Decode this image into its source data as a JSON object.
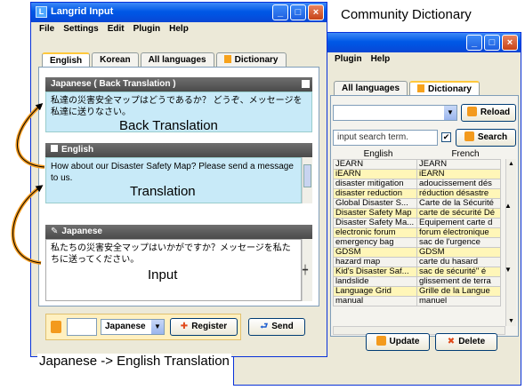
{
  "captions": {
    "community_dictionary": "Community Dictionary",
    "back_translation": "Back Translation",
    "translation": "Translation",
    "input": "Input",
    "bottom": "Japanese -> English Translation"
  },
  "main_window": {
    "title": "Langrid Input",
    "menu": [
      "File",
      "Settings",
      "Edit",
      "Plugin",
      "Help"
    ],
    "tabs": [
      "English",
      "Korean",
      "All languages",
      "Dictionary"
    ],
    "back_translation_header": "Japanese ( Back Translation )",
    "back_translation_text": "私達の災害安全マップはどうであるか？ どうぞ、メッセージを私達に送りなさい。",
    "english_header": "English",
    "english_text": "How about our Disaster Safety Map? Please send a message to us.",
    "japanese_header": "Japanese",
    "japanese_text": "私たちの災害安全マップはいかがですか？メッセージを私たちに送ってください。",
    "language_select": "Japanese",
    "register_label": "Register",
    "send_label": "Send"
  },
  "dict_window": {
    "menu": [
      "Plugin",
      "Help"
    ],
    "tabs": [
      "All languages",
      "Dictionary"
    ],
    "reload_label": "Reload",
    "search_placeholder": "input search term.",
    "search_label": "Search",
    "col_english": "English",
    "col_french": "French",
    "update_label": "Update",
    "delete_label": "Delete",
    "rows": [
      {
        "en": "JEARN",
        "fr": "JEARN",
        "hl": false
      },
      {
        "en": "iEARN",
        "fr": "iEARN",
        "hl": true
      },
      {
        "en": "disaster mitigation",
        "fr": "adoucissement dés",
        "hl": false
      },
      {
        "en": "disaster reduction",
        "fr": "réduction désastre",
        "hl": true
      },
      {
        "en": "Global Disaster S...",
        "fr": "Carte de la Sécurité",
        "hl": false
      },
      {
        "en": "Disaster Safety Map",
        "fr": "carte de sécurité Dé",
        "hl": true
      },
      {
        "en": "Disaster Safety Ma...",
        "fr": "Équipement carte d",
        "hl": false
      },
      {
        "en": "electronic forum",
        "fr": "forum électronique",
        "hl": true
      },
      {
        "en": "emergency bag",
        "fr": "sac de l'urgence",
        "hl": false
      },
      {
        "en": "GDSM",
        "fr": "GDSM",
        "hl": true
      },
      {
        "en": "hazard map",
        "fr": "carte du hasard",
        "hl": false
      },
      {
        "en": "Kid's Disaster Saf...",
        "fr": "sac de sécurité\" é",
        "hl": true
      },
      {
        "en": "landslide",
        "fr": "glissement de terra",
        "hl": false
      },
      {
        "en": "Language Grid",
        "fr": "Grille de la Langue",
        "hl": true
      },
      {
        "en": "manual",
        "fr": "manuel",
        "hl": false
      }
    ]
  }
}
